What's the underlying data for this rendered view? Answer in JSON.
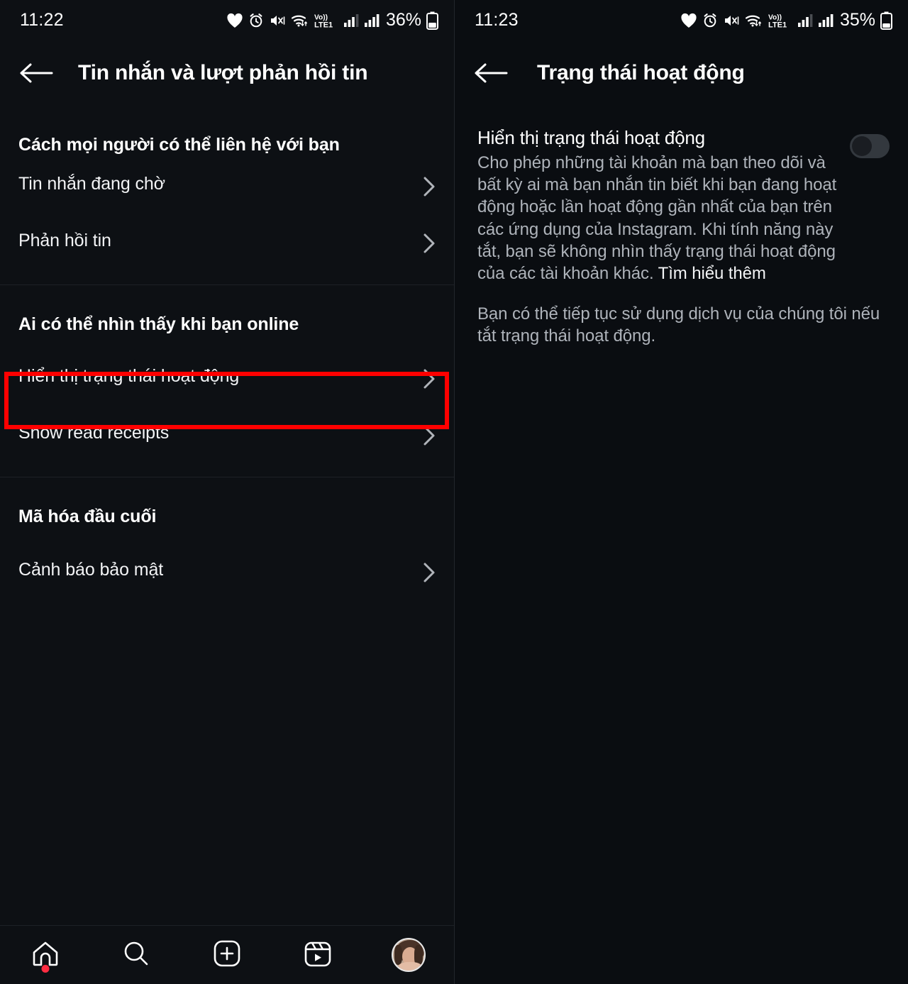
{
  "left": {
    "statusbar": {
      "time": "11:22",
      "battery_percent": "36%",
      "icons": [
        "heart-icon",
        "alarm-icon",
        "mute-vibrate-icon",
        "wifi-icon",
        "volte-icon",
        "signal-1-icon",
        "signal-2-icon",
        "battery-icon"
      ],
      "network_label": "Vo)) LTE1"
    },
    "appbar": {
      "back": "back-arrow-icon",
      "title": "Tin nhắn và lượt phản hồi tin"
    },
    "sections": [
      {
        "title": "Cách mọi người có thể liên hệ với bạn",
        "rows": [
          {
            "label": "Tin nhắn đang chờ",
            "chevron": "chevron-right-icon"
          },
          {
            "label": "Phản hồi tin",
            "chevron": "chevron-right-icon"
          }
        ]
      },
      {
        "title": "Ai có thể nhìn thấy khi bạn online",
        "rows": [
          {
            "label": "Hiển thị trạng thái hoạt động",
            "chevron": "chevron-right-icon"
          },
          {
            "label": "Show read receipts",
            "chevron": "chevron-right-icon"
          }
        ]
      },
      {
        "title": "Mã hóa đầu cuối",
        "rows": [
          {
            "label": "Cảnh báo bảo mật",
            "chevron": "chevron-right-icon"
          }
        ]
      }
    ],
    "bottom_nav": [
      {
        "name": "home-icon",
        "badge": true
      },
      {
        "name": "search-icon",
        "badge": false
      },
      {
        "name": "create-plus-icon",
        "badge": false
      },
      {
        "name": "reels-icon",
        "badge": false
      },
      {
        "name": "profile-avatar",
        "badge": false
      }
    ]
  },
  "right": {
    "statusbar": {
      "time": "11:23",
      "battery_percent": "35%",
      "network_label": "Vo)) LTE1"
    },
    "appbar": {
      "back": "back-arrow-icon",
      "title": "Trạng thái hoạt động"
    },
    "setting": {
      "title": "Hiển thị trạng thái hoạt động",
      "description": "Cho phép những tài khoản mà bạn theo dõi và bất kỳ ai mà bạn nhắn tin biết khi bạn đang hoạt động hoặc lần hoạt động gần nhất của bạn trên các ứng dụng của Instagram. Khi tính năng này tắt, bạn sẽ không nhìn thấy trạng thái hoạt động của các tài khoản khác. ",
      "learn_more": "Tìm hiểu thêm",
      "description2": "Bạn có thể tiếp tục sử dụng dịch vụ của chúng tôi nếu tắt trạng thái hoạt động.",
      "toggle_state": "off"
    }
  },
  "annotation": {
    "highlight_color": "#ff0000"
  }
}
